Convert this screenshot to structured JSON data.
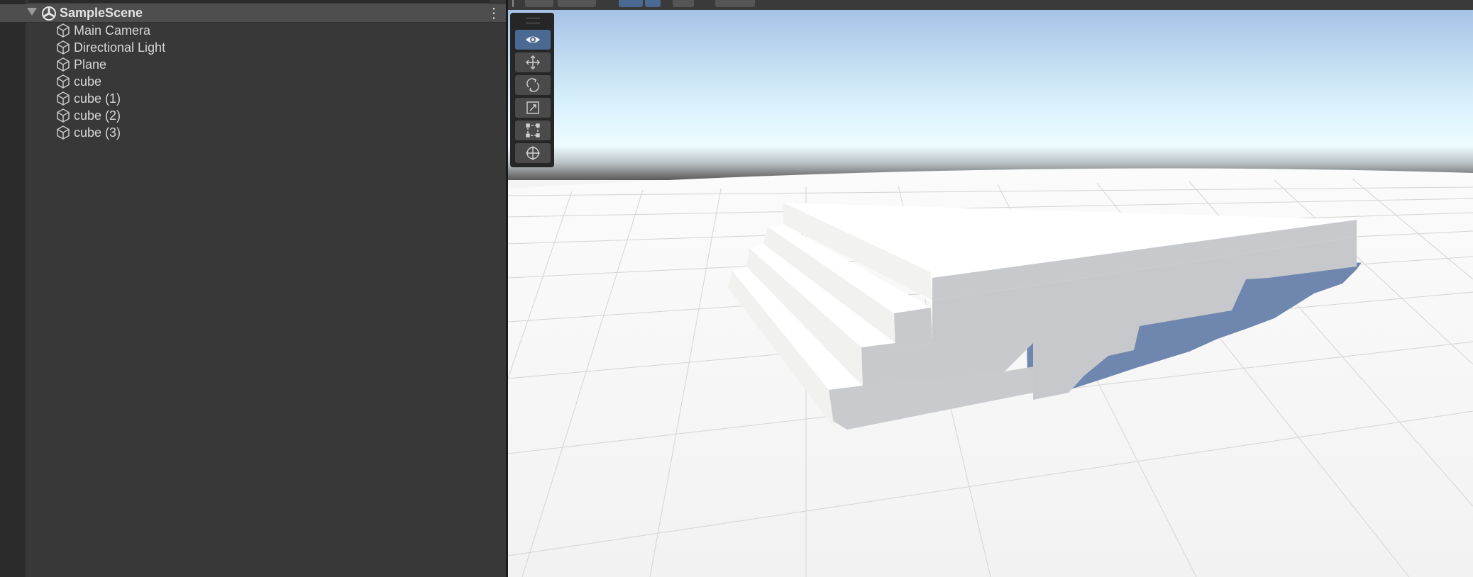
{
  "hierarchy": {
    "scene": {
      "name": "SampleScene",
      "icon": "unity-scene-icon",
      "expanded": true
    },
    "items": [
      {
        "label": "Main Camera",
        "icon": "gameobject-cube-icon"
      },
      {
        "label": "Directional Light",
        "icon": "gameobject-cube-icon"
      },
      {
        "label": "Plane",
        "icon": "gameobject-cube-icon"
      },
      {
        "label": "cube",
        "icon": "gameobject-cube-icon"
      },
      {
        "label": "cube (1)",
        "icon": "gameobject-cube-icon"
      },
      {
        "label": "cube (2)",
        "icon": "gameobject-cube-icon"
      },
      {
        "label": "cube (3)",
        "icon": "gameobject-cube-icon"
      }
    ],
    "menu_icon": "kebab-menu-icon"
  },
  "scene_view": {
    "tools": [
      {
        "name": "view-tool",
        "icon": "eye-icon",
        "active": true
      },
      {
        "name": "move-tool",
        "icon": "move-arrows-icon",
        "active": false
      },
      {
        "name": "rotate-tool",
        "icon": "rotate-icon",
        "active": false
      },
      {
        "name": "scale-tool",
        "icon": "scale-icon",
        "active": false
      },
      {
        "name": "rect-tool",
        "icon": "rect-transform-icon",
        "active": false
      },
      {
        "name": "transform-tool",
        "icon": "transform-icon",
        "active": false
      }
    ],
    "colors": {
      "sky_top": "#a8c6e8",
      "sky_horizon": "#ecfaff",
      "ground": "#f3f3f3",
      "grid": "#d6d6d6",
      "stair_top": "#ffffff",
      "stair_side": "#c6c8cb",
      "stair_front": "#f0f0ee",
      "shadow": "#6e86ad",
      "active_tool": "#4a6a93"
    }
  }
}
